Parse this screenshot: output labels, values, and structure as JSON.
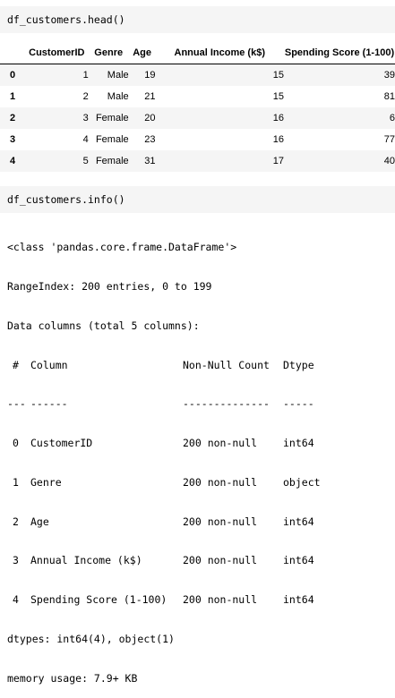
{
  "cell1": {
    "code": "df_customers.head()"
  },
  "table": {
    "columns": [
      "",
      "CustomerID",
      "Genre",
      "Age",
      "Annual Income (k$)",
      "Spending Score (1-100)"
    ],
    "rows": [
      {
        "index": "0",
        "values": [
          "1",
          "Male",
          "19",
          "15",
          "39"
        ]
      },
      {
        "index": "1",
        "values": [
          "2",
          "Male",
          "21",
          "15",
          "81"
        ]
      },
      {
        "index": "2",
        "values": [
          "3",
          "Female",
          "20",
          "16",
          "6"
        ]
      },
      {
        "index": "3",
        "values": [
          "4",
          "Female",
          "23",
          "16",
          "77"
        ]
      },
      {
        "index": "4",
        "values": [
          "5",
          "Female",
          "31",
          "17",
          "40"
        ]
      }
    ]
  },
  "cell2": {
    "code": "df_customers.info()"
  },
  "info": {
    "class_line": "<class 'pandas.core.frame.DataFrame'>",
    "range_line": "RangeIndex: 200 entries, 0 to 199",
    "data_columns_line": "Data columns (total 5 columns):",
    "header": {
      "num": "#",
      "column": "Column",
      "non_null": "Non-Null Count",
      "dtype": "Dtype"
    },
    "separator": {
      "num": "---",
      "column": "------",
      "non_null": "--------------",
      "dtype": "-----"
    },
    "rows": [
      {
        "num": "0",
        "column": "CustomerID",
        "non_null": "200 non-null",
        "dtype": "int64"
      },
      {
        "num": "1",
        "column": "Genre",
        "non_null": "200 non-null",
        "dtype": "object"
      },
      {
        "num": "2",
        "column": "Age",
        "non_null": "200 non-null",
        "dtype": "int64"
      },
      {
        "num": "3",
        "column": "Annual Income (k$)",
        "non_null": "200 non-null",
        "dtype": "int64"
      },
      {
        "num": "4",
        "column": "Spending Score (1-100)",
        "non_null": "200 non-null",
        "dtype": "int64"
      }
    ],
    "dtypes_line": "dtypes: int64(4), object(1)",
    "memory_line": "memory usage: 7.9+ KB"
  }
}
